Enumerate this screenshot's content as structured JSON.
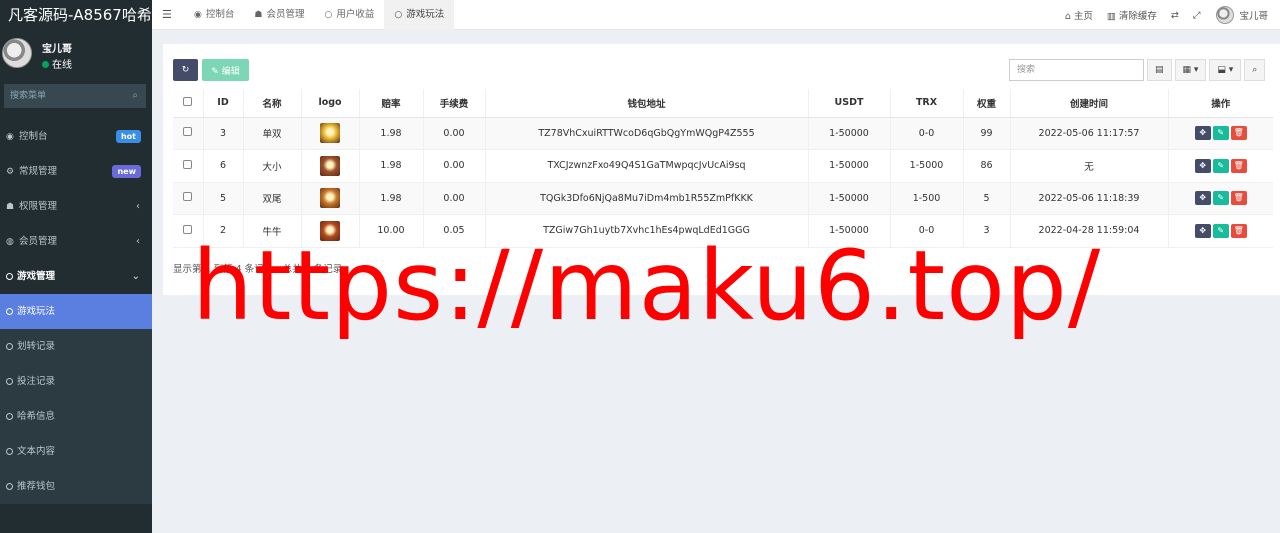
{
  "brand": "凡客源码-A8567哈希",
  "user": {
    "name": "宝儿哥",
    "status": "在线"
  },
  "menu_search": {
    "placeholder": "搜索菜单"
  },
  "menu": [
    {
      "label": "控制台",
      "icon": "dashboard-icon",
      "glyph": "◉",
      "badge": "hot"
    },
    {
      "label": "常规管理",
      "icon": "cogs-icon",
      "glyph": "⚙",
      "badge": "new"
    },
    {
      "label": "权限管理",
      "icon": "group-icon",
      "glyph": "☗",
      "caret": "‹"
    },
    {
      "label": "会员管理",
      "icon": "user-circle-icon",
      "glyph": "◍",
      "caret": "‹"
    },
    {
      "label": "游戏管理",
      "icon": "circle-icon",
      "caret": "⌄"
    }
  ],
  "submenu_active": "游戏玩法",
  "submenu_rest": [
    "划转记录",
    "投注记录",
    "哈希信息",
    "文本内容",
    "推荐钱包"
  ],
  "topnav": {
    "tabs": [
      {
        "label": "控制台",
        "glyph": "◉"
      },
      {
        "label": "会员管理",
        "glyph": "☗"
      },
      {
        "label": "用户收益",
        "glyph": "○"
      },
      {
        "label": "游戏玩法",
        "glyph": "○"
      }
    ],
    "home": "主页",
    "clear_cache": "清除缓存",
    "user": "宝儿哥"
  },
  "toolbar": {
    "edit": "编辑",
    "search_placeholder": "搜索"
  },
  "table": {
    "headers": [
      "ID",
      "名称",
      "logo",
      "赔率",
      "手续费",
      "钱包地址",
      "USDT",
      "TRX",
      "权重",
      "创建时间",
      "操作"
    ],
    "rows": [
      {
        "id": "3",
        "name": "单双",
        "rate": "1.98",
        "fee": "0.00",
        "address": "TZ78VhCxuiRTTWcoD6qGbQgYmWQgP4Z555",
        "usdt": "1-50000",
        "trx": "0-0",
        "weight": "99",
        "created": "2022-05-06 11:17:57",
        "logo_color": "#e8b830"
      },
      {
        "id": "6",
        "name": "大小",
        "rate": "1.98",
        "fee": "0.00",
        "address": "TXCJzwnzFxo49Q4S1GaTMwpqcJvUcAi9sq",
        "usdt": "1-50000",
        "trx": "1-5000",
        "weight": "86",
        "created": "无",
        "logo_color": "#a0522d"
      },
      {
        "id": "5",
        "name": "双尾",
        "rate": "1.98",
        "fee": "0.00",
        "address": "TQGk3Dfo6NjQa8Mu7iDm4mb1R55ZmPfKKK",
        "usdt": "1-50000",
        "trx": "1-500",
        "weight": "5",
        "created": "2022-05-06 11:18:39",
        "logo_color": "#c9782a"
      },
      {
        "id": "2",
        "name": "牛牛",
        "rate": "10.00",
        "fee": "0.05",
        "address": "TZGiw7Gh1uytb7Xvhc1hEs4pwqLdEd1GGG",
        "usdt": "1-50000",
        "trx": "0-0",
        "weight": "3",
        "created": "2022-04-28 11:59:04",
        "logo_color": "#b5471e"
      }
    ]
  },
  "pager": "显示第 1 到第 4 条记录，总共 4 条记录",
  "watermark": "https://maku6.top/"
}
